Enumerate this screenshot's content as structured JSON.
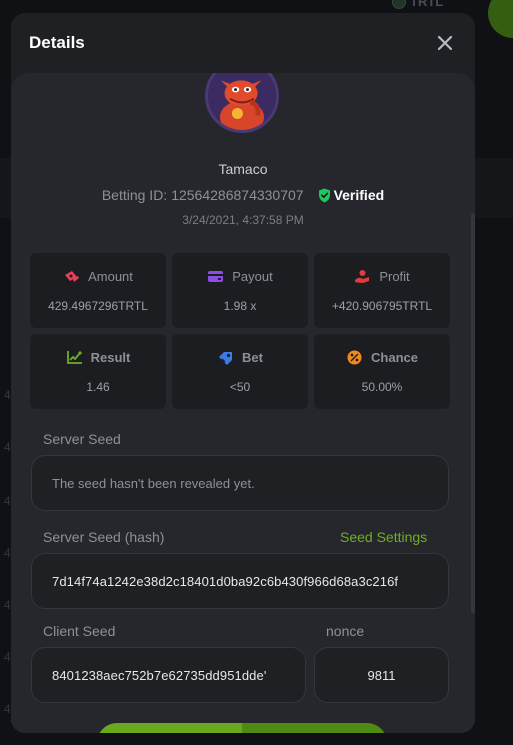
{
  "background": {
    "currency_chip": "TRTL",
    "digit": "4"
  },
  "modal": {
    "title": "Details",
    "user": {
      "username": "Tamaco",
      "betting_id_label": "Betting ID:",
      "betting_id": "12564286874330707",
      "verified_label": "Verified",
      "timestamp": "3/24/2021, 4:37:58 PM"
    },
    "stats": [
      {
        "label": "Amount",
        "value": "429.4967296TRTL",
        "icon": "amount-icon",
        "color": "#e8405a"
      },
      {
        "label": "Payout",
        "value": "1.98 x",
        "icon": "wallet-icon",
        "color": "#8a4de8"
      },
      {
        "label": "Profit",
        "value": "+420.906795TRTL",
        "icon": "profit-icon",
        "color": "#e03a3a"
      },
      {
        "label": "Result",
        "value": "1.46",
        "icon": "result-chart-icon",
        "color": "#6fae25"
      },
      {
        "label": "Bet",
        "value": "<50",
        "icon": "bet-tag-icon",
        "color": "#3a7be8"
      },
      {
        "label": "Chance",
        "value": "50.00%",
        "icon": "percent-icon",
        "color": "#f08a1c"
      }
    ],
    "server_seed": {
      "label": "Server Seed",
      "value": "The seed hasn't been revealed yet."
    },
    "server_seed_hash": {
      "label": "Server Seed (hash)",
      "settings_link": "Seed Settings",
      "value": "7d14f74a1242e38d2c18401d0ba92c6b430f966d68a3c216f"
    },
    "client_seed": {
      "label": "Client Seed",
      "value": "8401238aec752b7e62735dd951dde'"
    },
    "nonce": {
      "label": "nonce",
      "value": "9811"
    }
  },
  "colors": {
    "accent_green": "#6fae25",
    "verified_green": "#22c55e",
    "modal_bg": "#1f2024",
    "card_bg": "#1c1d21"
  }
}
